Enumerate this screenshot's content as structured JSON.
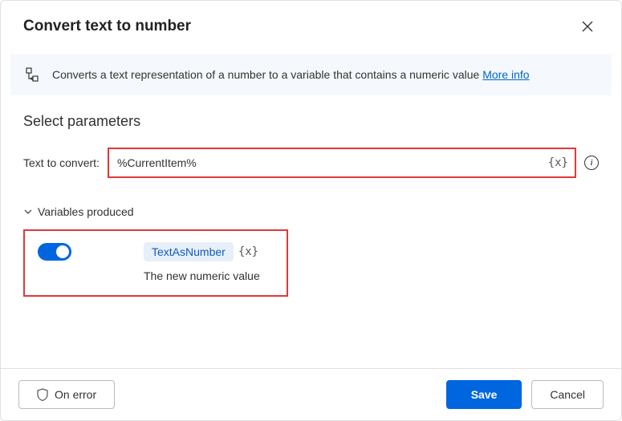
{
  "dialog": {
    "title": "Convert text to number"
  },
  "banner": {
    "text": "Converts a text representation of a number to a variable that contains a numeric value ",
    "link": "More info"
  },
  "params": {
    "section_title": "Select parameters",
    "text_to_convert_label": "Text to convert:",
    "text_to_convert_value": "%CurrentItem%"
  },
  "vars_produced": {
    "header": "Variables produced",
    "toggle_on": true,
    "variable_name": "TextAsNumber",
    "description": "The new numeric value"
  },
  "footer": {
    "on_error": "On error",
    "save": "Save",
    "cancel": "Cancel"
  }
}
